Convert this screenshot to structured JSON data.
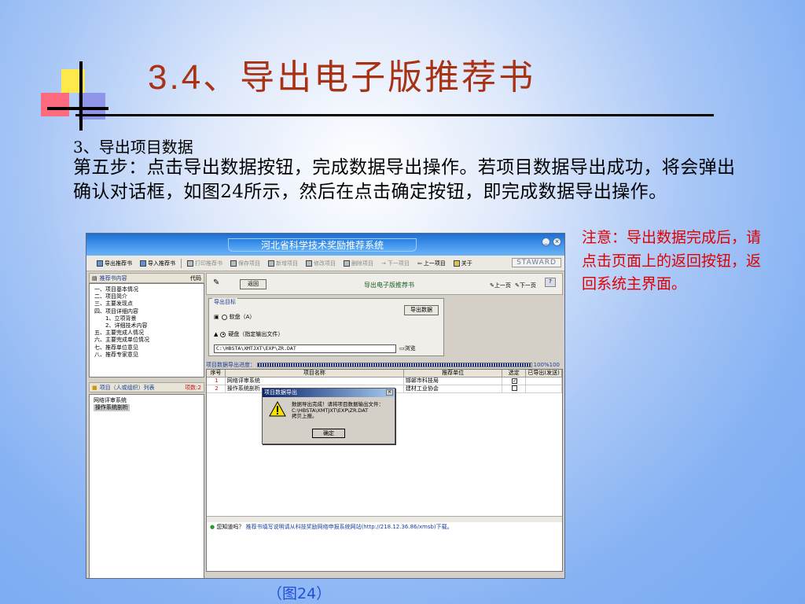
{
  "slide": {
    "title": "3.4、导出电子版推荐书",
    "subheading": "3、导出项目数据",
    "body": "第五步：点击导出数据按钮，完成数据导出操作。若项目数据导出成功，将会弹出确认对话框，如图24所示，然后在点击确定按钮，即完成数据导出操作。",
    "note": "注意：导出数据完成后，请点击页面上的返回按钮，返回系统主界面。",
    "caption": "（图24）"
  },
  "app": {
    "title": "河北省科学技术奖励推荐系统",
    "window_controls": [
      "_",
      "×"
    ],
    "brand": "STAWARD",
    "toolbar": [
      {
        "label": "导出推荐书",
        "enabled": true
      },
      {
        "label": "导入推荐书",
        "enabled": true
      },
      {
        "label": "打印推荐书",
        "enabled": false
      },
      {
        "label": "保存项目",
        "enabled": false
      },
      {
        "label": "新增项目",
        "enabled": false
      },
      {
        "label": "修改项目",
        "enabled": false
      },
      {
        "label": "删除项目",
        "enabled": false
      },
      {
        "label": "下一项目",
        "enabled": false
      },
      {
        "label": "上一项目",
        "enabled": true
      },
      {
        "label": "关于",
        "enabled": true
      }
    ],
    "left_panel": {
      "header": "推荐书内容",
      "header_right": "代码",
      "tree": [
        {
          "label": "一、项目基本情况",
          "level": 1
        },
        {
          "label": "二、项目简介",
          "level": 1
        },
        {
          "label": "三、主要发现点",
          "level": 1
        },
        {
          "label": "四、项目详细内容",
          "level": 1
        },
        {
          "label": "1、立项背景",
          "level": 2
        },
        {
          "label": "2、详细技术内容",
          "level": 2
        },
        {
          "label": "五、主要完成人情况",
          "level": 1
        },
        {
          "label": "六、主要完成单位情况",
          "level": 1
        },
        {
          "label": "七、推荐单位意见",
          "level": 1
        },
        {
          "label": "八、推荐专家意见",
          "level": 1
        }
      ],
      "list_header": "项目（人或组织）列表",
      "list_count": "项数:2",
      "list_items": [
        "网络评审系统",
        "操作系统剖析"
      ]
    },
    "right_panel": {
      "back_button": "返回",
      "title": "导出电子版推荐书",
      "prev_page": "上一页",
      "next_page": "下一页",
      "group_label": "导出目标",
      "export_button": "导出数据",
      "radio_floppy": "软盘（A）",
      "radio_disk": "硬盘（指定输出文件）",
      "path_value": "C:\\HBSTA\\XMTJXT\\EXP\\ZR.DAT",
      "browse": "浏览",
      "progress_label": "项目数据导出进度：",
      "progress_value": 1.0,
      "progress_text": "100%100",
      "table": {
        "columns": [
          "序号",
          "项目名称",
          "推荐单位",
          "选定",
          "已导出(发送)"
        ],
        "rows": [
          {
            "no": "1",
            "name": "网络评审系统",
            "unit": "邯郸市科技局",
            "checked": "✓"
          },
          {
            "no": "2",
            "name": "操作系统剖析",
            "unit": "建材工业协会",
            "checked": ""
          }
        ]
      },
      "tip_question": "您知道吗？",
      "tip_text": "推荐书填写说明请从科技奖励网络申报系统网站(http://218.12.36.86/xmsb)下载。"
    },
    "dialog": {
      "title": "项目数据导出",
      "message_line1": "数据导出完成！请将项目数据输出文件：",
      "message_line2": "C:\\HBSTA\\XMTJXT\\EXP\\ZR.DAT",
      "message_line3": "拷贝上报。",
      "ok_button": "确定",
      "close": "×"
    }
  }
}
